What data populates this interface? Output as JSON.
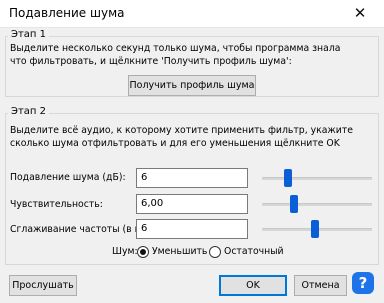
{
  "window": {
    "title": "Подавление шума",
    "close_glyph": "✕"
  },
  "step1": {
    "legend": "Этап 1",
    "instruction_line1": "Выделите несколько секунд только шума, чтобы программа знала",
    "instruction_line2": "что фильтровать, и щёлкните 'Получить профиль шума':",
    "get_profile_button": "Получить профиль шума"
  },
  "step2": {
    "legend": "Этап 2",
    "instruction_line1": "Выделите всё аудио, к которому хотите применить фильтр, укажите",
    "instruction_line2": "сколько шума отфильтровать и для его уменьшения щёлкните OK",
    "settings": [
      {
        "label": "Подавление шума (дБ):",
        "value": "6",
        "slider_fraction": 0.22
      },
      {
        "label": "Чувствительность:",
        "value": "6,00",
        "slider_fraction": 0.27
      },
      {
        "label": "Сглаживание частоты (в полосах):",
        "value": "6",
        "slider_fraction": 0.48
      }
    ],
    "noise_label": "Шум:",
    "noise_options": [
      {
        "label": "Уменьшить",
        "selected": true
      },
      {
        "label": "Остаточный",
        "selected": false
      }
    ]
  },
  "footer": {
    "preview_button": "Прослушать",
    "ok_button": "OK",
    "cancel_button": "Отмена",
    "help_icon": "?"
  },
  "colors": {
    "accent": "#0a5fd6",
    "help": "#1e73e8"
  }
}
